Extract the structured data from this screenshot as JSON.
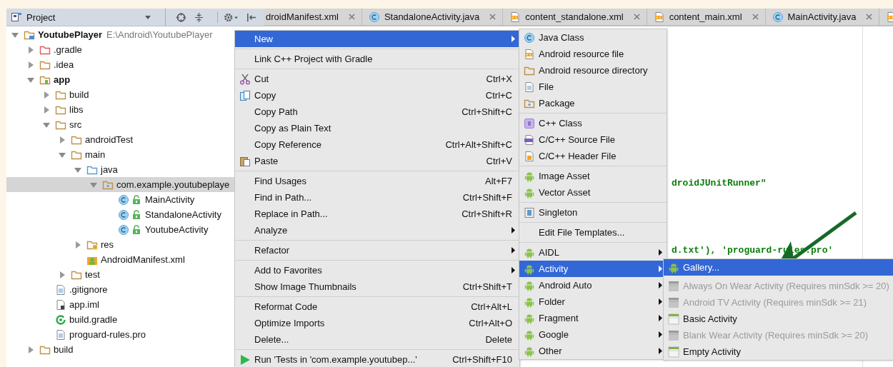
{
  "project_panel": {
    "title": "Project"
  },
  "tabs": [
    {
      "label": "droidManifest.xml",
      "kind": "none",
      "selected": false
    },
    {
      "label": "StandaloneActivity.java",
      "kind": "java-class",
      "selected": false
    },
    {
      "label": "content_standalone.xml",
      "kind": "resource-file",
      "selected": false
    },
    {
      "label": "content_main.xml",
      "kind": "resource-file",
      "selected": false
    },
    {
      "label": "MainActivity.java",
      "kind": "java-class",
      "selected": false
    },
    {
      "kind": "resource-file",
      "selected": false
    }
  ],
  "tree": [
    {
      "label": "YoutubePlayer",
      "path": "E:\\Android\\YoutubePlayer",
      "kind": "project",
      "bold": true,
      "expanded": true,
      "selected": false,
      "children": [
        {
          "label": ".gradle",
          "kind": "folder-excluded",
          "bold": false,
          "expanded": false,
          "selected": false
        },
        {
          "label": ".idea",
          "kind": "folder",
          "bold": false,
          "expanded": false,
          "selected": false
        },
        {
          "label": "app",
          "kind": "module",
          "bold": true,
          "expanded": true,
          "selected": false,
          "children": [
            {
              "label": "build",
              "kind": "folder",
              "bold": false,
              "expanded": false,
              "selected": false
            },
            {
              "label": "libs",
              "kind": "folder",
              "bold": false,
              "expanded": false,
              "selected": false
            },
            {
              "label": "src",
              "kind": "folder",
              "bold": false,
              "expanded": true,
              "selected": false,
              "children": [
                {
                  "label": "androidTest",
                  "kind": "folder",
                  "bold": false,
                  "expanded": false,
                  "selected": false
                },
                {
                  "label": "main",
                  "kind": "folder",
                  "bold": false,
                  "expanded": true,
                  "selected": false,
                  "children": [
                    {
                      "label": "java",
                      "kind": "folder-source",
                      "bold": false,
                      "expanded": true,
                      "selected": false,
                      "children": [
                        {
                          "label": "com.example.youtubeplaye",
                          "kind": "package",
                          "bold": false,
                          "expanded": true,
                          "selected": true,
                          "children": [
                            {
                              "label": "MainActivity",
                              "kind": "java-class",
                              "bold": false,
                              "selected": false
                            },
                            {
                              "label": "StandaloneActivity",
                              "kind": "java-class",
                              "bold": false,
                              "selected": false
                            },
                            {
                              "label": "YoutubeActivity",
                              "kind": "java-class",
                              "bold": false,
                              "selected": false
                            }
                          ]
                        }
                      ]
                    },
                    {
                      "label": "res",
                      "kind": "folder-res",
                      "bold": false,
                      "expanded": false,
                      "selected": false
                    },
                    {
                      "label": "AndroidManifest.xml",
                      "kind": "manifest",
                      "bold": false,
                      "selected": false
                    }
                  ]
                },
                {
                  "label": "test",
                  "kind": "folder",
                  "bold": false,
                  "expanded": false,
                  "selected": false
                }
              ]
            },
            {
              "label": ".gitignore",
              "kind": "file",
              "bold": false,
              "selected": false
            },
            {
              "label": "app.iml",
              "kind": "iml",
              "bold": false,
              "selected": false
            },
            {
              "label": "build.gradle",
              "kind": "gradle",
              "bold": false,
              "selected": false
            },
            {
              "label": "proguard-rules.pro",
              "kind": "file",
              "bold": false,
              "selected": false
            }
          ]
        },
        {
          "label": "build",
          "kind": "folder",
          "bold": false,
          "expanded": false,
          "selected": false
        }
      ]
    }
  ],
  "editor": {
    "lines": [
      "droidJUnitRunner\"",
      "d.txt'), 'proguard-rules.pro'"
    ]
  },
  "context_menu": {
    "groups": [
      [
        {
          "label": "New",
          "kind": "none",
          "has_submenu": true,
          "selected": true
        }
      ],
      [
        {
          "label": "Link C++ Project with Gradle",
          "kind": "none",
          "has_submenu": false,
          "selected": false
        }
      ],
      [
        {
          "label": "Cut",
          "kind": "cut",
          "shortcut": "Ctrl+X",
          "has_submenu": false,
          "selected": false
        },
        {
          "label": "Copy",
          "kind": "copy",
          "shortcut": "Ctrl+C",
          "has_submenu": false,
          "selected": false
        },
        {
          "label": "Copy Path",
          "kind": "none",
          "shortcut": "Ctrl+Shift+C",
          "has_submenu": false,
          "selected": false
        },
        {
          "label": "Copy as Plain Text",
          "kind": "none",
          "has_submenu": false,
          "selected": false
        },
        {
          "label": "Copy Reference",
          "kind": "none",
          "shortcut": "Ctrl+Alt+Shift+C",
          "has_submenu": false,
          "selected": false
        },
        {
          "label": "Paste",
          "kind": "paste",
          "shortcut": "Ctrl+V",
          "has_submenu": false,
          "selected": false
        }
      ],
      [
        {
          "label": "Find Usages",
          "kind": "none",
          "shortcut": "Alt+F7",
          "has_submenu": false,
          "selected": false
        },
        {
          "label": "Find in Path...",
          "kind": "none",
          "shortcut": "Ctrl+Shift+F",
          "has_submenu": false,
          "selected": false
        },
        {
          "label": "Replace in Path...",
          "kind": "none",
          "shortcut": "Ctrl+Shift+R",
          "has_submenu": false,
          "selected": false
        },
        {
          "label": "Analyze",
          "kind": "none",
          "has_submenu": true,
          "selected": false
        }
      ],
      [
        {
          "label": "Refactor",
          "kind": "none",
          "has_submenu": true,
          "selected": false
        }
      ],
      [
        {
          "label": "Add to Favorites",
          "kind": "none",
          "has_submenu": true,
          "selected": false
        },
        {
          "label": "Show Image Thumbnails",
          "kind": "none",
          "shortcut": "Ctrl+Shift+T",
          "has_submenu": false,
          "selected": false
        }
      ],
      [
        {
          "label": "Reformat Code",
          "kind": "none",
          "shortcut": "Ctrl+Alt+L",
          "has_submenu": false,
          "selected": false
        },
        {
          "label": "Optimize Imports",
          "kind": "none",
          "shortcut": "Ctrl+Alt+O",
          "has_submenu": false,
          "selected": false
        },
        {
          "label": "Delete...",
          "kind": "none",
          "shortcut": "Delete",
          "has_submenu": false,
          "selected": false
        }
      ],
      [
        {
          "label": "Run 'Tests in 'com.example.youtubep...'",
          "kind": "run",
          "shortcut": "Ctrl+Shift+F10",
          "has_submenu": false,
          "selected": false
        }
      ]
    ]
  },
  "new_submenu": {
    "groups": [
      [
        {
          "label": "Java Class",
          "kind": "java-class",
          "has_submenu": false,
          "selected": false
        },
        {
          "label": "Android resource file",
          "kind": "resource-file",
          "has_submenu": false,
          "selected": false
        },
        {
          "label": "Android resource directory",
          "kind": "folder",
          "has_submenu": false,
          "selected": false
        },
        {
          "label": "File",
          "kind": "file",
          "has_submenu": false,
          "selected": false
        },
        {
          "label": "Package",
          "kind": "package",
          "has_submenu": false,
          "selected": false
        }
      ],
      [
        {
          "label": "C++ Class",
          "kind": "cpp-class",
          "has_submenu": false,
          "selected": false
        },
        {
          "label": "C/C++ Source File",
          "kind": "cpp-source",
          "has_submenu": false,
          "selected": false
        },
        {
          "label": "C/C++ Header File",
          "kind": "cpp-header",
          "has_submenu": false,
          "selected": false
        }
      ],
      [
        {
          "label": "Image Asset",
          "kind": "android",
          "has_submenu": false,
          "selected": false
        },
        {
          "label": "Vector Asset",
          "kind": "android",
          "has_submenu": false,
          "selected": false
        }
      ],
      [
        {
          "label": "Singleton",
          "kind": "singleton",
          "has_submenu": false,
          "selected": false
        }
      ],
      [
        {
          "label": "Edit File Templates...",
          "kind": "none",
          "has_submenu": false,
          "selected": false
        }
      ],
      [
        {
          "label": "AIDL",
          "kind": "android",
          "has_submenu": true,
          "selected": false
        },
        {
          "label": "Activity",
          "kind": "android",
          "has_submenu": true,
          "selected": true
        },
        {
          "label": "Android Auto",
          "kind": "android",
          "has_submenu": true,
          "selected": false
        },
        {
          "label": "Folder",
          "kind": "android",
          "has_submenu": true,
          "selected": false
        },
        {
          "label": "Fragment",
          "kind": "android",
          "has_submenu": true,
          "selected": false
        },
        {
          "label": "Google",
          "kind": "android",
          "has_submenu": true,
          "selected": false
        },
        {
          "label": "Other",
          "kind": "android",
          "has_submenu": true,
          "selected": false
        }
      ]
    ]
  },
  "activity_submenu": {
    "items": [
      {
        "label": "Gallery...",
        "kind": "android",
        "disabled": false,
        "selected": true
      },
      {
        "label": "Always On Wear Activity (Requires minSdk >= 20)",
        "kind": "template",
        "disabled": true,
        "selected": false
      },
      {
        "label": "Android TV Activity (Requires minSdk >= 21)",
        "kind": "template",
        "disabled": true,
        "selected": false
      },
      {
        "label": "Basic Activity",
        "kind": "template",
        "disabled": false,
        "selected": false
      },
      {
        "label": "Blank Wear Activity (Requires minSdk >= 20)",
        "kind": "template",
        "disabled": true,
        "selected": false
      },
      {
        "label": "Empty Activity",
        "kind": "template",
        "disabled": false,
        "selected": false
      }
    ]
  }
}
